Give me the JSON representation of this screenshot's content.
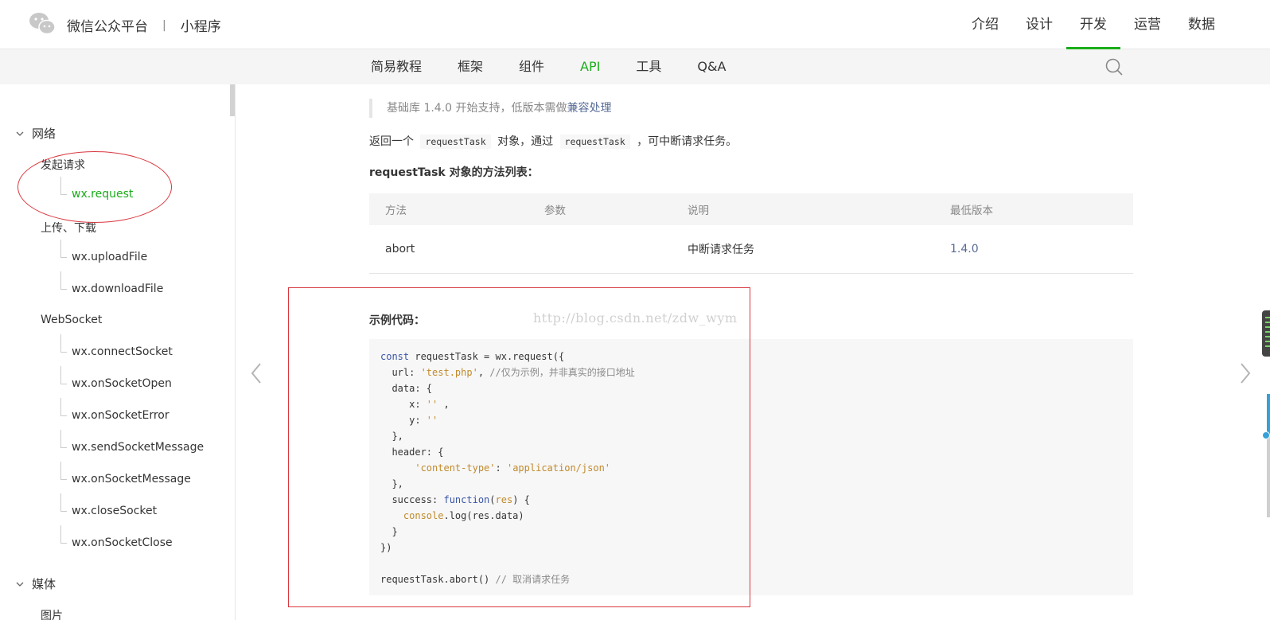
{
  "header": {
    "brand": "微信公众平台",
    "separator": "|",
    "product": "小程序",
    "nav": [
      {
        "label": "介绍",
        "active": false
      },
      {
        "label": "设计",
        "active": false
      },
      {
        "label": "开发",
        "active": true
      },
      {
        "label": "运营",
        "active": false
      },
      {
        "label": "数据",
        "active": false
      }
    ]
  },
  "subnav": {
    "tabs": [
      {
        "label": "简易教程",
        "active": false
      },
      {
        "label": "框架",
        "active": false
      },
      {
        "label": "组件",
        "active": false
      },
      {
        "label": "API",
        "active": true
      },
      {
        "label": "工具",
        "active": false
      },
      {
        "label": "Q&A",
        "active": false
      }
    ],
    "search_icon": "search-icon"
  },
  "sidebar": {
    "group_network": "网络",
    "sub_request": "发起请求",
    "leaf_request": "wx.request",
    "sub_upload": "上传、下载",
    "leaf_upload": "wx.uploadFile",
    "leaf_download": "wx.downloadFile",
    "sub_websocket": "WebSocket",
    "leaf_connect": "wx.connectSocket",
    "leaf_open": "wx.onSocketOpen",
    "leaf_error": "wx.onSocketError",
    "leaf_send": "wx.sendSocketMessage",
    "leaf_message": "wx.onSocketMessage",
    "leaf_close": "wx.closeSocket",
    "leaf_onclose": "wx.onSocketClose",
    "group_media": "媒体",
    "sub_image": "图片"
  },
  "content": {
    "note_prefix": "基础库 1.4.0 开始支持，低版本需做",
    "note_link": "兼容处理",
    "para_1": "返回一个",
    "para_code_1": "requestTask",
    "para_2": "对象，通过",
    "para_code_2": "requestTask",
    "para_3": "，可中断请求任务。",
    "subhead": "requestTask 对象的方法列表：",
    "table": {
      "headers": [
        "方法",
        "参数",
        "说明",
        "最低版本"
      ],
      "rows": [
        {
          "method": "abort",
          "params": "",
          "desc": "中断请求任务",
          "version": "1.4.0"
        }
      ]
    },
    "example_title": "示例代码：",
    "code": {
      "l1a": "const",
      "l1b": " requestTask = wx.request({",
      "l2a": "  url: ",
      "l2b": "'test.php'",
      "l2c": ", ",
      "l2d": "//仅为示例，并非真实的接口地址",
      "l3": "  data: {",
      "l4a": "     x: ",
      "l4b": "''",
      "l4c": " ,",
      "l5a": "     y: ",
      "l5b": "''",
      "l6": "  },",
      "l7": "  header: {",
      "l8a": "      ",
      "l8b": "'content-type'",
      "l8c": ": ",
      "l8d": "'application/json'",
      "l9": "  },",
      "l10a": "  success: ",
      "l10b": "function",
      "l10c": "(",
      "l10d": "res",
      "l10e": ") {",
      "l11a": "    ",
      "l11b": "console",
      "l11c": ".log(res.data)",
      "l12": "  }",
      "l13": "})",
      "l14a": "requestTask.abort() ",
      "l14b": "// 取消请求任务"
    }
  },
  "watermark": "http://blog.csdn.net/zdw_wym",
  "arrows": {
    "prev": "chevron-left-icon",
    "next": "chevron-right-icon"
  }
}
